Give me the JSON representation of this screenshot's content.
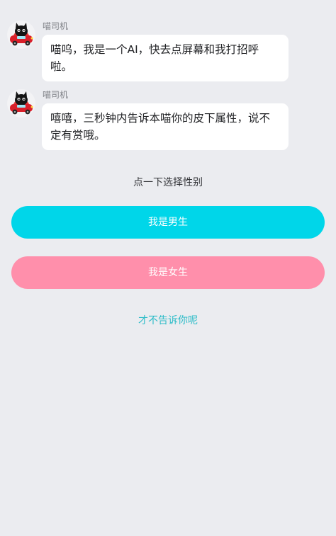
{
  "messages": [
    {
      "sender": "喵司机",
      "text": "喵呜，我是一个AI，快去点屏幕和我打招呼啦。",
      "avatar_icon": "black-cat-in-red-car-icon"
    },
    {
      "sender": "喵司机",
      "text": "嘻嘻，三秒钟内告诉本喵你的皮下属性，说不定有赏哦。",
      "avatar_icon": "black-cat-in-red-car-icon"
    }
  ],
  "prompt": "点一下选择性别",
  "buttons": {
    "male": "我是男生",
    "female": "我是女生",
    "skip": "才不告诉你呢"
  },
  "colors": {
    "background": "#ebecf0",
    "male_button": "#00d6e9",
    "female_button": "#ff8fab",
    "skip_link": "#2dbcc8"
  }
}
